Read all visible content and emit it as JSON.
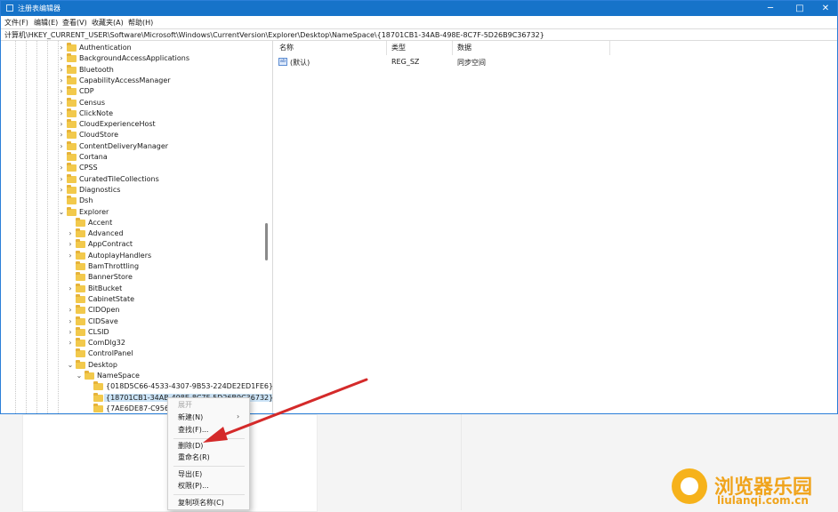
{
  "window": {
    "title": "注册表编辑器",
    "minimize": "─",
    "maximize": "□",
    "close": "✕"
  },
  "menu": [
    "文件(F)",
    "编辑(E)",
    "查看(V)",
    "收藏夹(A)",
    "帮助(H)"
  ],
  "address": "计算机\\HKEY_CURRENT_USER\\Software\\Microsoft\\Windows\\CurrentVersion\\Explorer\\Desktop\\NameSpace\\{18701CB1-34AB-498E-8C7F-5D26B9C36732}",
  "tree": [
    {
      "label": "Authentication",
      "twisty": "›"
    },
    {
      "label": "BackgroundAccessApplications",
      "twisty": "›"
    },
    {
      "label": "Bluetooth",
      "twisty": "›"
    },
    {
      "label": "CapabilityAccessManager",
      "twisty": "›"
    },
    {
      "label": "CDP",
      "twisty": "›"
    },
    {
      "label": "Census",
      "twisty": "›"
    },
    {
      "label": "ClickNote",
      "twisty": "›"
    },
    {
      "label": "CloudExperienceHost",
      "twisty": "›"
    },
    {
      "label": "CloudStore",
      "twisty": "›"
    },
    {
      "label": "ContentDeliveryManager",
      "twisty": "›"
    },
    {
      "label": "Cortana",
      "twisty": ""
    },
    {
      "label": "CPSS",
      "twisty": "›"
    },
    {
      "label": "CuratedTileCollections",
      "twisty": "›"
    },
    {
      "label": "Diagnostics",
      "twisty": "›"
    },
    {
      "label": "Dsh",
      "twisty": ""
    },
    {
      "label": "Explorer",
      "twisty": "⌄"
    },
    {
      "label": "Accent",
      "twisty": ""
    },
    {
      "label": "Advanced",
      "twisty": "›"
    },
    {
      "label": "AppContract",
      "twisty": "›"
    },
    {
      "label": "AutoplayHandlers",
      "twisty": "›"
    },
    {
      "label": "BamThrottling",
      "twisty": ""
    },
    {
      "label": "BannerStore",
      "twisty": ""
    },
    {
      "label": "BitBucket",
      "twisty": "›"
    },
    {
      "label": "CabinetState",
      "twisty": ""
    },
    {
      "label": "CIDOpen",
      "twisty": "›"
    },
    {
      "label": "CIDSave",
      "twisty": "›"
    },
    {
      "label": "CLSID",
      "twisty": "›"
    },
    {
      "label": "ComDlg32",
      "twisty": "›"
    },
    {
      "label": "ControlPanel",
      "twisty": ""
    },
    {
      "label": "Desktop",
      "twisty": "⌄"
    },
    {
      "label": "NameSpace",
      "twisty": "⌄"
    },
    {
      "label": "{018D5C66-4533-4307-9B53-224DE2ED1FE6}",
      "twisty": ""
    },
    {
      "label": "{18701CB1-34AB-498E-8C7F-5D26B9C36732}",
      "twisty": ""
    },
    {
      "label": "{7AE6DE87-C956-",
      "twisty": ""
    }
  ],
  "columns": {
    "name": "名称",
    "type": "类型",
    "data": "数据"
  },
  "values": [
    {
      "icon": "ab",
      "name": "(默认)",
      "type": "REG_SZ",
      "data": "同步空间"
    }
  ],
  "context_menu": {
    "expand": "展开",
    "new": "新建(N)",
    "new_arrow": "›",
    "find": "查找(F)...",
    "delete": "删除(D)",
    "rename": "重命名(R)",
    "export": "导出(E)",
    "permissions": "权限(P)...",
    "copy_key_name": "复制项名称(C)"
  },
  "watermark": {
    "cn": "浏览器乐园",
    "en": "liulanqi.com.cn"
  },
  "colors": {
    "titlebar": "#1673c9",
    "selection": "#cce4f7",
    "arrow": "#d42a2a",
    "watermark": "#f0a41c"
  }
}
